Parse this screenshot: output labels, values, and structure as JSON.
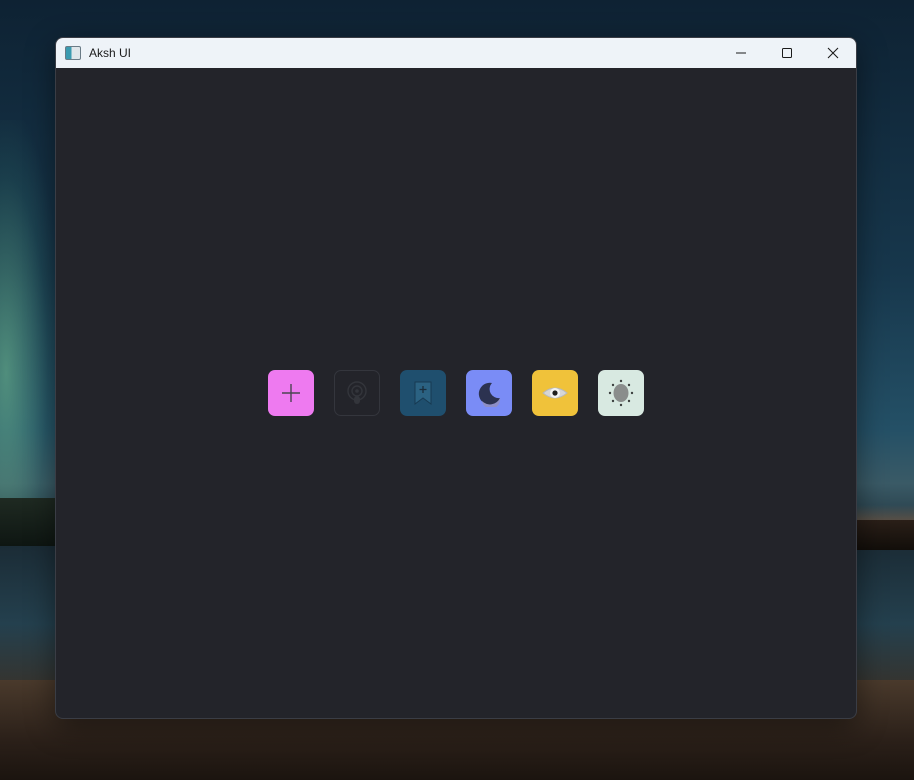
{
  "window": {
    "title": "Aksh UI",
    "icon": "app-window-icon"
  },
  "controls": [
    {
      "name": "minimize",
      "icon": "minimize-icon"
    },
    {
      "name": "maximize",
      "icon": "maximize-icon"
    },
    {
      "name": "close",
      "icon": "close-icon"
    }
  ],
  "toolbar": {
    "buttons": [
      {
        "name": "add",
        "icon": "plus-icon",
        "color": "#ee7af0"
      },
      {
        "name": "podcast",
        "icon": "podcast-icon",
        "color": "#26272c"
      },
      {
        "name": "bookmark",
        "icon": "bookmark-add-icon",
        "color": "#1f4f6e"
      },
      {
        "name": "dark-mode",
        "icon": "moon-icon",
        "color": "#7a8cf6"
      },
      {
        "name": "view",
        "icon": "eye-icon",
        "color": "#f0c23a"
      },
      {
        "name": "light-mode",
        "icon": "sun-icon",
        "color": "#d8e9e1"
      }
    ]
  },
  "colors": {
    "window_background": "#23242a",
    "titlebar_background": "#eef3f8"
  }
}
